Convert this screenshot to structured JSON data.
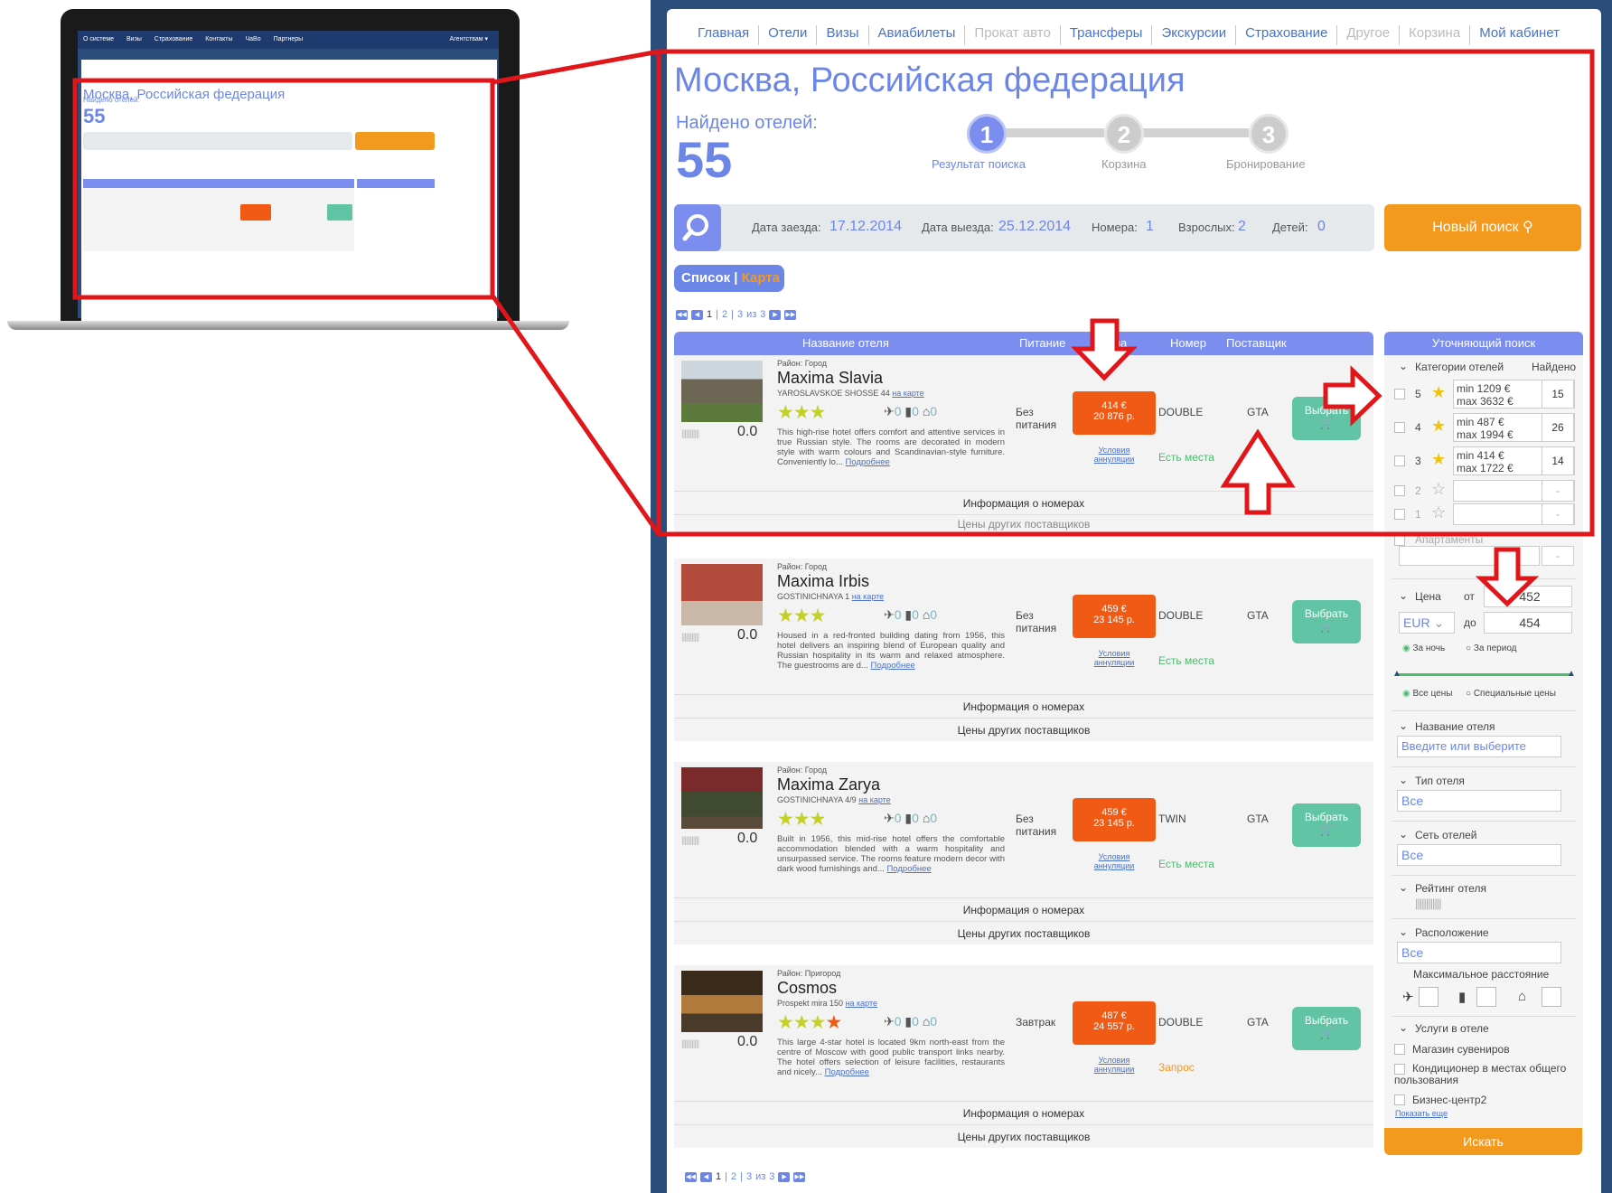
{
  "laptop": {
    "topnav": [
      "О системе",
      "Визы",
      "Страхование",
      "Контакты",
      "ЧаВо",
      "Партнеры"
    ],
    "agency": "Агентствам ▾"
  },
  "topnav": [
    {
      "label": "Главная"
    },
    {
      "label": "Отели"
    },
    {
      "label": "Визы"
    },
    {
      "label": "Авиабилеты"
    },
    {
      "label": "Прокат авто",
      "dim": true
    },
    {
      "label": "Трансферы"
    },
    {
      "label": "Экскурсии"
    },
    {
      "label": "Страхование"
    },
    {
      "label": "Другое",
      "dim": true
    },
    {
      "label": "Корзина",
      "dim": true
    },
    {
      "label": "Мой кабинет"
    }
  ],
  "city": "Москва, Российская федерация",
  "found_label": "Найдено отелей:",
  "found_count": "55",
  "steps": [
    {
      "num": "1",
      "label": "Результат поиска"
    },
    {
      "num": "2",
      "label": "Корзина"
    },
    {
      "num": "3",
      "label": "Бронирование"
    }
  ],
  "search": {
    "checkin_label": "Дата заезда:",
    "checkin": "17.12.2014",
    "checkout_label": "Дата выезда:",
    "checkout": "25.12.2014",
    "rooms_label": "Номера:",
    "rooms": "1",
    "adults_label": "Взрослых:",
    "adults": "2",
    "children_label": "Детей:",
    "children": "0",
    "new_search": "Новый поиск"
  },
  "view": {
    "list": "Список",
    "map": "Карта"
  },
  "pager": {
    "p1": "1",
    "p2": "2",
    "p3": "3",
    "of": "из",
    "total": "3"
  },
  "columns": {
    "name": "Название отеля",
    "meal": "Питание",
    "price": "Цена",
    "room": "Номер",
    "supplier": "Поставщик"
  },
  "hotels": [
    {
      "district": "Район: Город",
      "name": "Maxima Slavia",
      "address": "YAROSLAVSKOE SHOSSE 44",
      "map": "на карте",
      "stars": "★★★",
      "score": "0.0",
      "air": "0",
      "train": "0",
      "metro": "0",
      "desc": "This high-rise hotel offers comfort and attentive services in true Russian style. The rooms are decorated in modern style with warm colours and Scandinavian-style furniture. Conveniently lo...",
      "more": "Подробнее",
      "meal": "Без питания",
      "price_eur": "414 €",
      "price_rub": "20 876 р.",
      "cancel": "Условия аннуляции",
      "room": "DOUBLE",
      "supplier": "GTA",
      "avail": "Есть места",
      "choose": "Выбрать",
      "info": "Информация о номерах",
      "other": "Цены других поставщиков"
    },
    {
      "district": "Район: Город",
      "name": "Maxima Irbis",
      "address": "GOSTINICHNAYA 1",
      "map": "на карте",
      "stars": "★★★",
      "score": "0.0",
      "air": "0",
      "train": "0",
      "metro": "0",
      "desc": "Housed in a red-fronted building dating from 1956, this hotel delivers an inspiring blend of European quality and Russian hospitality in its warm and relaxed atmosphere. The guestrooms are d...",
      "more": "Подробнее",
      "meal": "Без питания",
      "price_eur": "459 €",
      "price_rub": "23 145 р.",
      "cancel": "Условия аннуляции",
      "room": "DOUBLE",
      "supplier": "GTA",
      "avail": "Есть места",
      "choose": "Выбрать",
      "info": "Информация о номерах",
      "other": "Цены других поставщиков"
    },
    {
      "district": "Район: Город",
      "name": "Maxima Zarya",
      "address": "GOSTINICHNAYA 4/9",
      "map": "на карте",
      "stars": "★★★",
      "score": "0.0",
      "air": "0",
      "train": "0",
      "metro": "0",
      "desc": "Built in 1956, this mid-rise hotel offers the comfortable accommodation blended with a warm hospitality and unsurpassed service. The rooms feature modern decor with dark wood furnishings and...",
      "more": "Подробнее",
      "meal": "Без питания",
      "price_eur": "459 €",
      "price_rub": "23 145 р.",
      "cancel": "Условия аннуляции",
      "room": "TWIN",
      "supplier": "GTA",
      "avail": "Есть места",
      "choose": "Выбрать",
      "info": "Информация о номерах",
      "other": "Цены других поставщиков"
    },
    {
      "district": "Район: Пригород",
      "name": "Cosmos",
      "address": "Prospekt mira 150",
      "map": "на карте",
      "stars": "★★★",
      "star4": "★",
      "score": "0.0",
      "air": "0",
      "train": "0",
      "metro": "0",
      "desc": "This large 4-star hotel is located 9km north-east from the centre of Moscow with good public transport links nearby. The hotel offers selection of leisure facilities, restaurants and nicely...",
      "more": "Подробнее",
      "meal": "Завтрак",
      "price_eur": "487 €",
      "price_rub": "24 557 р.",
      "cancel": "Условия аннуляции",
      "room": "DOUBLE",
      "supplier": "GTA",
      "avail": "Запрос",
      "choose": "Выбрать",
      "info": "Информация о номерах",
      "other": "Цены других поставщиков"
    }
  ],
  "refine": {
    "title": "Уточняющий поиск",
    "categories_label": "Категории отелей",
    "found_label": "Найдено",
    "categories": [
      {
        "n": "5",
        "min": "min 1209 €",
        "max": "max 3632 €",
        "count": "15"
      },
      {
        "n": "4",
        "min": "min 487 €",
        "max": "max 1994 €",
        "count": "26"
      },
      {
        "n": "3",
        "min": "min 414 €",
        "max": "max 1722 €",
        "count": "14"
      },
      {
        "n": "2",
        "count": "-"
      },
      {
        "n": "1",
        "count": "-"
      }
    ],
    "apartments": "Апартаменты",
    "apart_count": "-",
    "price_label": "Цена",
    "from": "от",
    "from_val": "452",
    "currency": "EUR",
    "to": "до",
    "to_val": "454",
    "per_night": "За ночь",
    "per_period": "За период",
    "all_prices": "Все цены",
    "special": "Специальные цены",
    "hotel_name_label": "Название отеля",
    "hotel_name_ph": "Введите или выберите",
    "type_label": "Тип отеля",
    "type_val": "Все",
    "chain_label": "Сеть отелей",
    "chain_val": "Все",
    "rating_label": "Рейтинг отеля",
    "location_label": "Расположение",
    "location_val": "Все",
    "max_dist": "Максимальное расстояние",
    "services_label": "Услуги в отеле",
    "services": [
      "Магазин сувениров",
      "Кондиционер в местах общего пользования",
      "Бизнес-центр2"
    ],
    "show_more": "Показать еще",
    "search_btn": "Искать"
  },
  "colors": {
    "accent": "#6c86e8",
    "orange": "#f39a1e",
    "price": "#f05a14",
    "highlight": "#e0161b"
  }
}
